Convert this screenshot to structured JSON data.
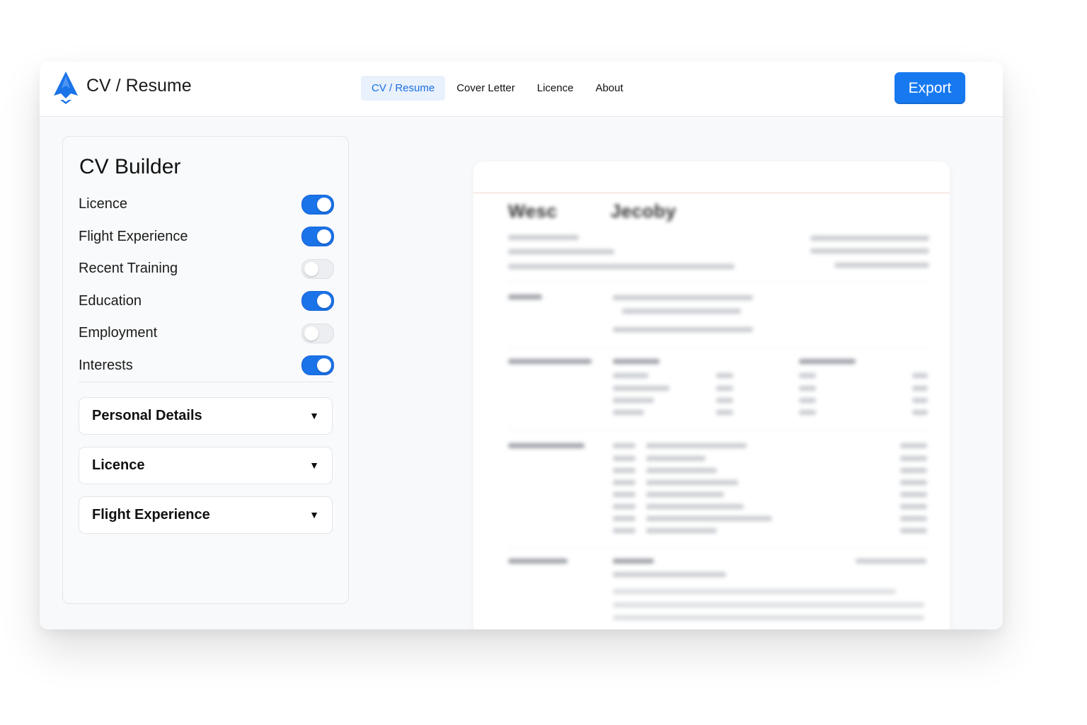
{
  "app": {
    "title": "CV / Resume"
  },
  "nav": {
    "tabs": [
      {
        "label": "CV / Resume",
        "active": true
      },
      {
        "label": "Cover Letter",
        "active": false
      },
      {
        "label": "Licence",
        "active": false
      },
      {
        "label": "About",
        "active": false
      }
    ]
  },
  "toolbar": {
    "export_label": "Export"
  },
  "builder": {
    "title": "CV Builder",
    "toggles": [
      {
        "label": "Licence",
        "on": true
      },
      {
        "label": "Flight Experience",
        "on": true
      },
      {
        "label": "Recent Training",
        "on": false
      },
      {
        "label": "Education",
        "on": true
      },
      {
        "label": "Employment",
        "on": false
      },
      {
        "label": "Interests",
        "on": true
      }
    ],
    "sections": [
      {
        "label": "Personal Details",
        "caret": "▼"
      },
      {
        "label": "Licence",
        "caret": "▼"
      },
      {
        "label": "Flight Experience",
        "caret": "▼"
      }
    ]
  },
  "preview": {
    "name_first": "Wesc",
    "name_last": "Jecoby"
  },
  "colors": {
    "accent": "#1679f0",
    "toggle_on": "#1a73e8",
    "toggle_off": "#eceef1",
    "active_tab_bg": "#e9f1fd"
  }
}
